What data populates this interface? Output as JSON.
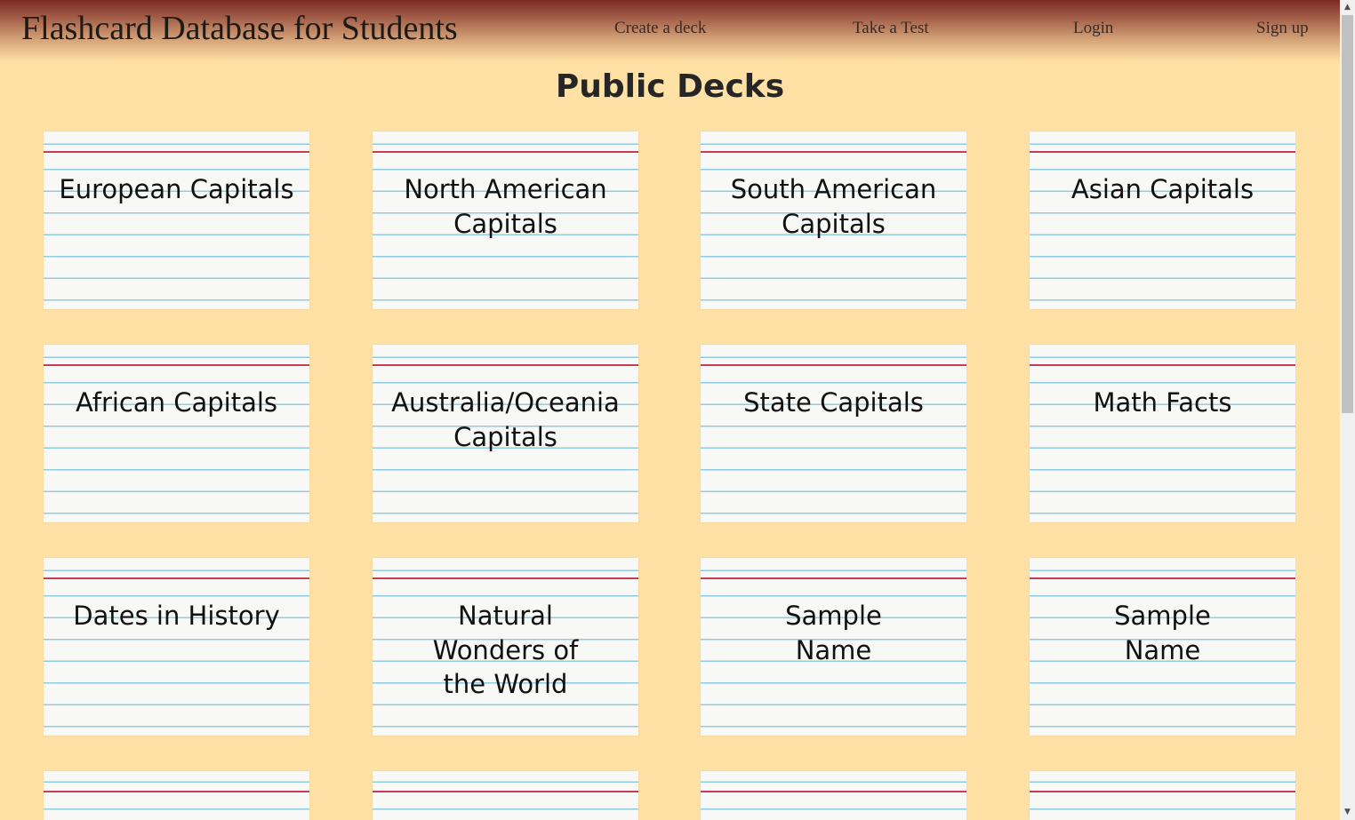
{
  "header": {
    "title": "Flashcard Database for Students",
    "nav": [
      {
        "label": "Create a deck"
      },
      {
        "label": "Take a Test"
      },
      {
        "label": "Login"
      },
      {
        "label": "Sign up"
      }
    ]
  },
  "main": {
    "heading": "Public Decks",
    "decks": [
      {
        "name": "European Capitals"
      },
      {
        "name": "North American Capitals"
      },
      {
        "name": "South American Capitals"
      },
      {
        "name": "Asian Capitals"
      },
      {
        "name": "African Capitals"
      },
      {
        "name": "Australia/Oceania Capitals"
      },
      {
        "name": "State Capitals"
      },
      {
        "name": "Math Facts"
      },
      {
        "name": "Dates in History"
      },
      {
        "name": "Natural Wonders of the World"
      },
      {
        "name": "Sample Name"
      },
      {
        "name": "Sample Name"
      },
      {
        "name": ""
      },
      {
        "name": ""
      },
      {
        "name": ""
      },
      {
        "name": ""
      }
    ]
  },
  "scrollbar": {
    "up_icon": "triangle-up-icon",
    "down_icon": "triangle-down-icon"
  },
  "colors": {
    "page_background": "#ffe1a6",
    "header_top": "#7a2a22",
    "card_background": "#f8f8f6",
    "card_red_line": "#c73b58",
    "card_blue_line": "#8fcbe2"
  }
}
